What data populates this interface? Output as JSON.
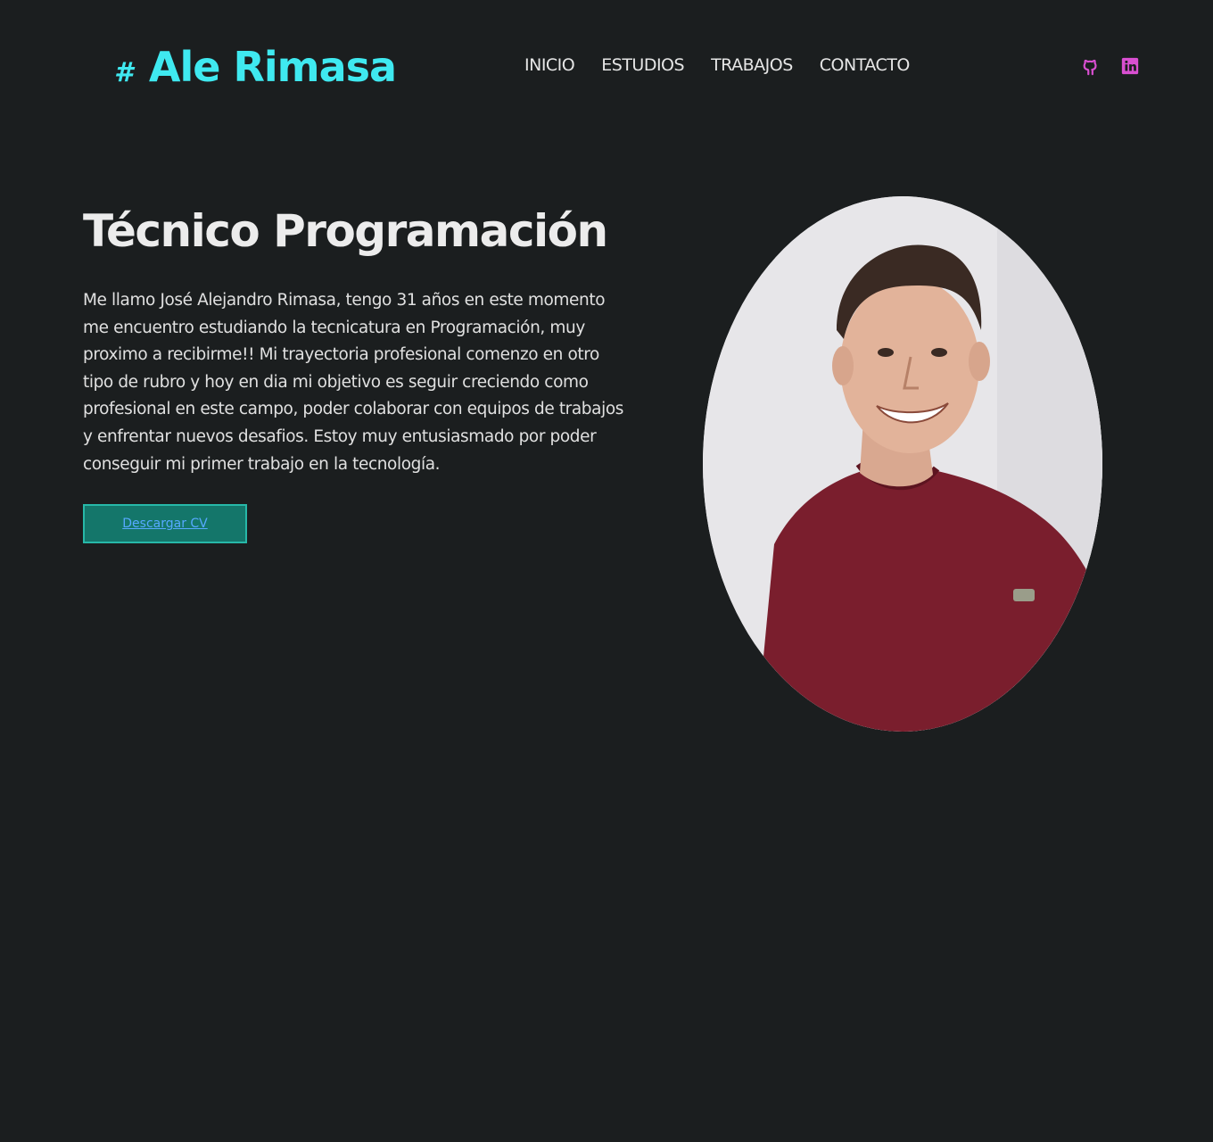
{
  "header": {
    "brand_hash": "#",
    "brand_name": "Ale Rimasa",
    "nav": [
      "INICIO",
      "ESTUDIOS",
      "TRABAJOS",
      "CONTACTO"
    ],
    "social_icons": [
      "github-icon",
      "linkedin-icon"
    ]
  },
  "hero": {
    "title": "Técnico Programación",
    "description": "Me llamo José Alejandro Rimasa, tengo 31 años en este momento me encuentro estudiando la tecnicatura en Programación, muy proximo a recibirme!! Mi trayectoria profesional comenzo en otro tipo de rubro y hoy en dia mi objetivo es seguir creciendo como profesional en este campo, poder colaborar con equipos de trabajos y enfrentar nuevos desafios. Estoy muy entusiasmado por poder conseguir mi primer trabajo en la tecnología.",
    "cv_button": "Descargar CV"
  },
  "colors": {
    "background": "#1b1e1f",
    "brand": "#3fe9f0",
    "social": "#d94fd1",
    "button_bg": "#14766a",
    "button_text": "#56a9ff"
  }
}
